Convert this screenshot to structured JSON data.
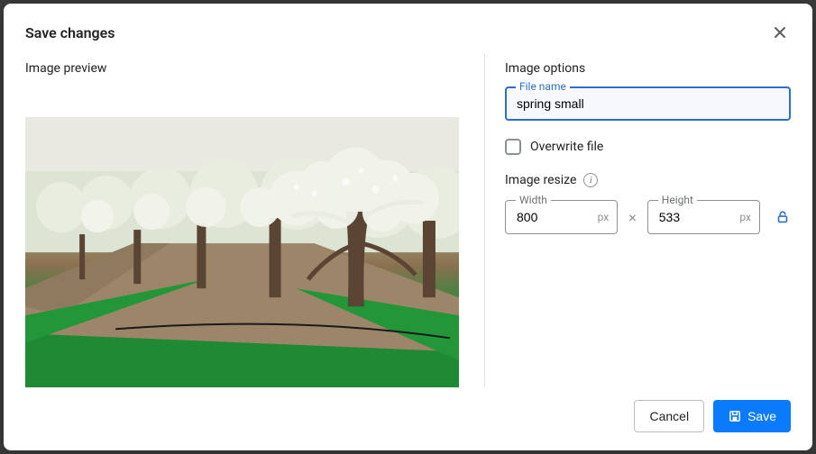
{
  "modal": {
    "title": "Save changes",
    "close_icon": "×"
  },
  "left": {
    "section_label": "Image preview"
  },
  "right": {
    "section_label": "Image options",
    "filename": {
      "label": "File name",
      "value": "spring small"
    },
    "overwrite": {
      "label": "Overwrite file",
      "checked": false
    },
    "resize": {
      "label": "Image resize",
      "width_label": "Width",
      "width_value": "800",
      "height_label": "Height",
      "height_value": "533",
      "unit": "px",
      "times": "×",
      "locked": true
    }
  },
  "footer": {
    "cancel": "Cancel",
    "save": "Save"
  },
  "colors": {
    "primary_blue": "#0a7aff",
    "focus_blue": "#2c6ecb",
    "border_gray": "#8c9196"
  }
}
